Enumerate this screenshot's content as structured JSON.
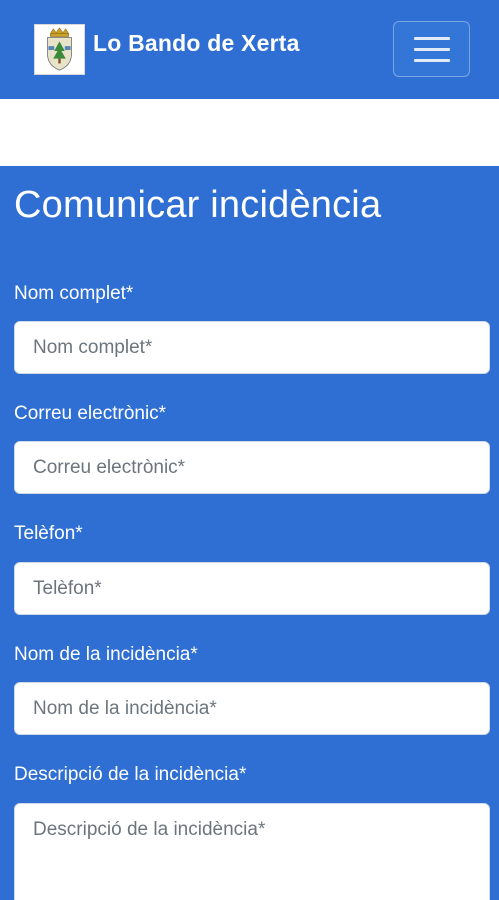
{
  "header": {
    "brand_title": "Lo Bando de Xerta",
    "logo_icon": "municipal-coat-of-arms",
    "menu_icon": "hamburger-menu-icon",
    "background_color": "#2f6fd3"
  },
  "form": {
    "title": "Comunicar incidència",
    "fields": [
      {
        "label": "Nom complet*",
        "placeholder": "Nom complet*"
      },
      {
        "label": "Correu electrònic*",
        "placeholder": "Correu electrònic*"
      },
      {
        "label": "Telèfon*",
        "placeholder": "Telèfon*"
      },
      {
        "label": "Nom de la incidència*",
        "placeholder": "Nom de la incidència*"
      },
      {
        "label": "Descripció de la incidència*",
        "placeholder": "Descripció de la incidència*"
      }
    ]
  }
}
